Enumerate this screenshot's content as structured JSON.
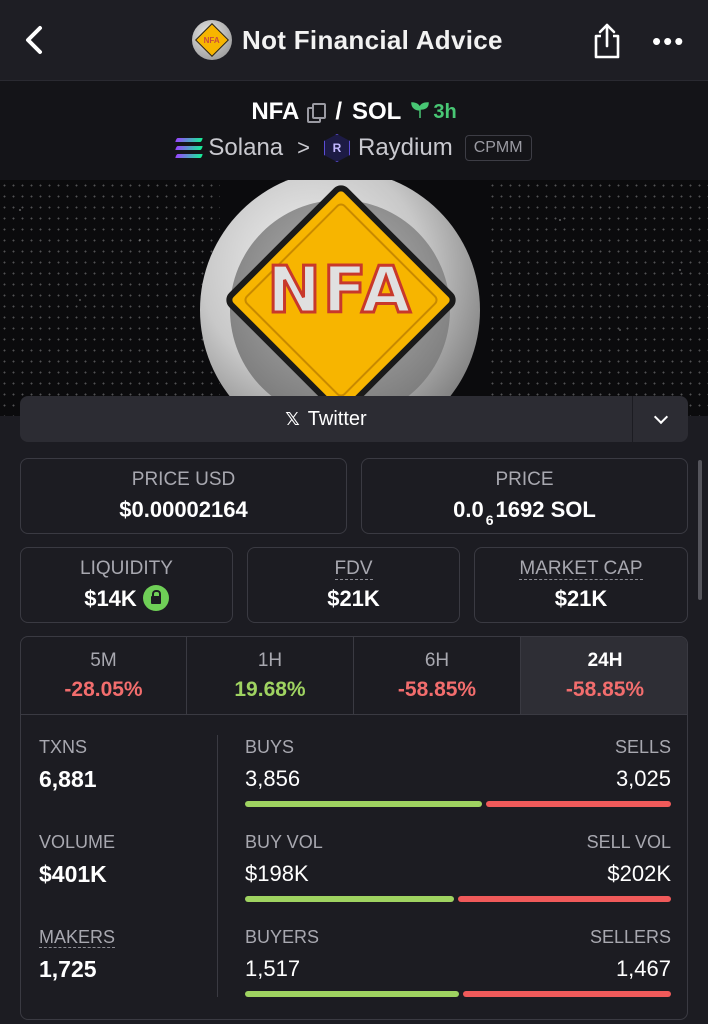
{
  "header": {
    "title": "Not Financial Advice",
    "logo_text": "NFA",
    "back_icon": "chevron-left-icon",
    "share_icon": "share-icon",
    "more_icon": "more-icon",
    "more_label": "•••"
  },
  "pair": {
    "base": "NFA",
    "separator": "/",
    "quote": "SOL",
    "age": "3h",
    "chain": "Solana",
    "chevron": ">",
    "dex": "Raydium",
    "dex_icon_letter": "R",
    "pool_type": "CPMM"
  },
  "banner": {
    "logo_text": "NFA"
  },
  "social": {
    "twitter_label": "Twitter",
    "x_glyph": "𝕏"
  },
  "prices": {
    "price_usd_label": "PRICE USD",
    "price_usd": "$0.00002164",
    "price_label": "PRICE",
    "price_prefix": "0.0",
    "price_zeros": "6",
    "price_suffix": "1692 SOL"
  },
  "metrics": {
    "liquidity_label": "LIQUIDITY",
    "liquidity": "$14K",
    "fdv_label": "FDV",
    "fdv": "$21K",
    "mcap_label": "MARKET CAP",
    "mcap": "$21K"
  },
  "timeframes": [
    {
      "label": "5M",
      "change": "-28.05%"
    },
    {
      "label": "1H",
      "change": "19.68%"
    },
    {
      "label": "6H",
      "change": "-58.85%"
    },
    {
      "label": "24H",
      "change": "-58.85%"
    }
  ],
  "stats": {
    "txns_label": "TXNS",
    "txns": "6,881",
    "volume_label": "VOLUME",
    "volume": "$401K",
    "makers_label": "MAKERS",
    "makers": "1,725",
    "buys_label": "BUYS",
    "buys": "3,856",
    "sells_label": "SELLS",
    "sells": "3,025",
    "buy_vol_label": "BUY VOL",
    "buy_vol": "$198K",
    "sell_vol_label": "SELL VOL",
    "sell_vol": "$202K",
    "buyers_label": "BUYERS",
    "buyers": "1,517",
    "sellers_label": "SELLERS",
    "sellers": "1,467"
  },
  "ratios": {
    "buys_share": 0.56,
    "buy_vol_share": 0.495,
    "buyers_share": 0.508
  },
  "colors": {
    "positive": "#9fd361",
    "negative": "#f26d6d",
    "accent_green": "#48c774"
  }
}
